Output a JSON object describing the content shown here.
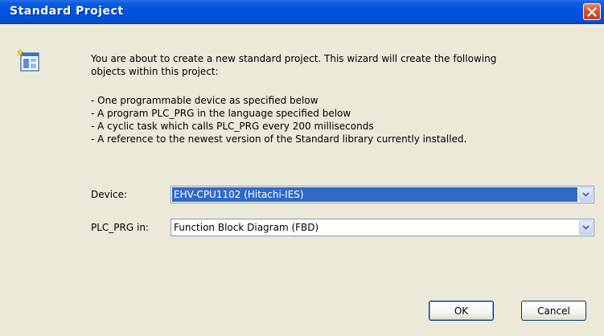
{
  "window": {
    "title": "Standard Project"
  },
  "message": {
    "line1": "You are about to create a new standard project. This wizard will create the following",
    "line2": "objects within this project:",
    "bullets": [
      "- One programmable device as specified below",
      "- A program PLC_PRG in the language specified below",
      "- A cyclic task which calls PLC_PRG every 200 milliseconds",
      "- A reference to the newest version of the Standard library currently installed."
    ]
  },
  "device": {
    "label": "Device:",
    "value": "EHV-CPU1102 (Hitachi-IES)"
  },
  "plc_prg": {
    "label": "PLC_PRG in:",
    "value": "Function Block Diagram (FBD)"
  },
  "buttons": {
    "ok": "OK",
    "cancel": "Cancel"
  },
  "colors": {
    "titlebar": "#0054e3",
    "dialog_bg": "#ece9d8",
    "selection": "#316ac5",
    "close_button": "#d8552a"
  },
  "icons": {
    "wizard": "new-project-wizard-icon",
    "close": "close-icon",
    "dropdown": "chevron-down-icon"
  }
}
